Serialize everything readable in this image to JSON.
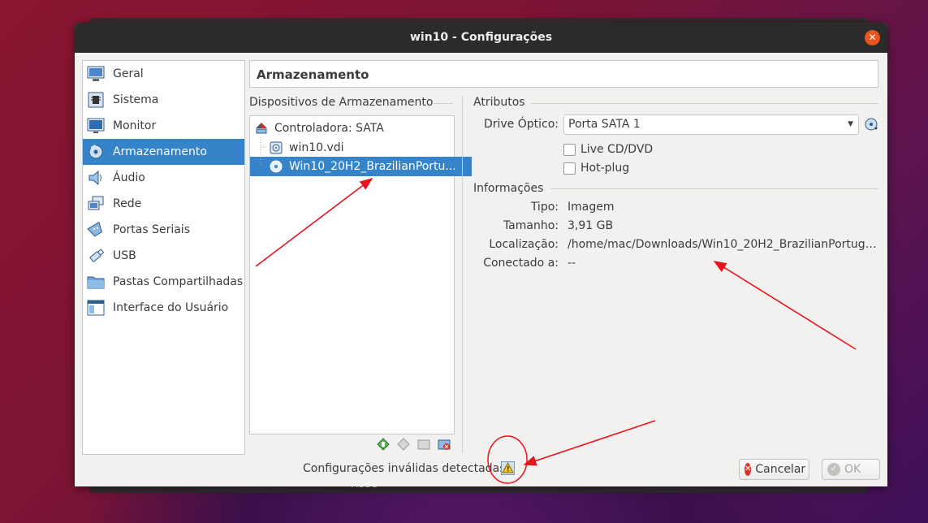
{
  "window": {
    "title": "win10 - Configurações",
    "background_text": "Rede"
  },
  "sidebar": {
    "items": [
      {
        "label": "Geral",
        "icon": "general-icon"
      },
      {
        "label": "Sistema",
        "icon": "chip-icon"
      },
      {
        "label": "Monitor",
        "icon": "monitor-icon"
      },
      {
        "label": "Armazenamento",
        "icon": "storage-icon",
        "selected": true
      },
      {
        "label": "Áudio",
        "icon": "speaker-icon"
      },
      {
        "label": "Rede",
        "icon": "network-icon"
      },
      {
        "label": "Portas Seriais",
        "icon": "serial-port-icon"
      },
      {
        "label": "USB",
        "icon": "usb-icon"
      },
      {
        "label": "Pastas Compartilhadas",
        "icon": "folder-icon"
      },
      {
        "label": "Interface do Usuário",
        "icon": "ui-window-icon"
      }
    ]
  },
  "page": {
    "title": "Armazenamento"
  },
  "storage": {
    "group_title": "Dispositivos de Armazenamento",
    "controller": "Controladora: SATA",
    "disk": "win10.vdi",
    "optical": "Win10_20H2_BrazilianPortu..."
  },
  "attributes": {
    "group_title": "Atributos",
    "drive_label": "Drive Óptico:",
    "drive_value": "Porta SATA 1",
    "live_cd": "Live CD/DVD",
    "hot_plug": "Hot-plug"
  },
  "info": {
    "group_title": "Informações",
    "type_label": "Tipo:",
    "type_value": "Imagem",
    "size_label": "Tamanho:",
    "size_value": "3,91 GB",
    "location_label": "Localização:",
    "location_value": "/home/mac/Downloads/Win10_20H2_BrazilianPortug…",
    "attached_label": "Conectado a:",
    "attached_value": "--"
  },
  "footer": {
    "status": "Configurações inválidas detectadas",
    "cancel": "Cancelar",
    "ok": "OK"
  },
  "colors": {
    "selection": "#3584c9",
    "titlebar": "#2b2b2b",
    "close": "#e95420",
    "annotation": "#e8141b"
  }
}
